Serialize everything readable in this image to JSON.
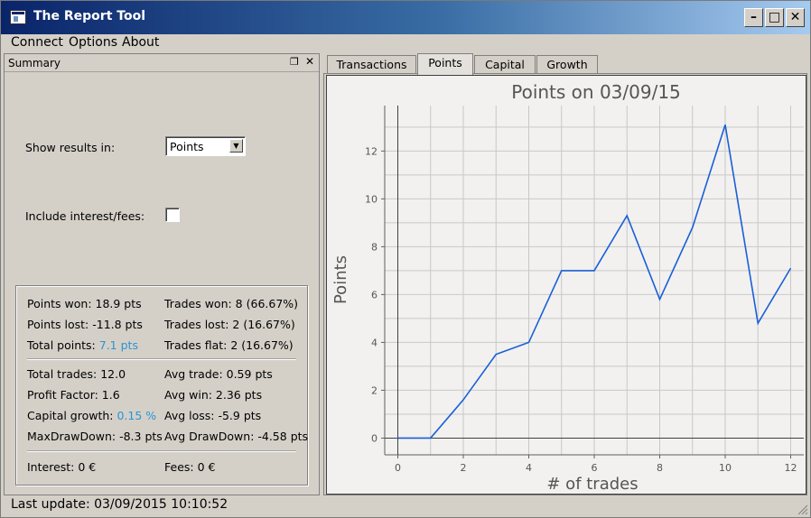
{
  "window": {
    "title": "The Report Tool"
  },
  "menu": {
    "connect": "Connect",
    "options": "Options",
    "about": "About"
  },
  "summary": {
    "title": "Summary",
    "show_results_label": "Show results in:",
    "show_results_value": "Points",
    "include_interest_label": "Include interest/fees:",
    "include_interest_checked": false,
    "stats": {
      "points_won": "Points won: 18.9 pts",
      "trades_won": "Trades won: 8 (66.67%)",
      "points_lost": "Points lost: -11.8 pts",
      "trades_lost": "Trades lost: 2 (16.67%)",
      "total_points_label": "Total points: ",
      "total_points_value": "7.1 pts",
      "trades_flat": "Trades flat: 2 (16.67%)",
      "total_trades": "Total trades: 12.0",
      "avg_trade": "Avg trade: 0.59 pts",
      "profit_factor": "Profit Factor: 1.6",
      "avg_win": "Avg win: 2.36 pts",
      "capital_growth_label": "Capital growth: ",
      "capital_growth_value": "0.15 %",
      "avg_loss": "Avg loss: -5.9 pts",
      "max_drawdown": "MaxDrawDown: -8.3 pts",
      "avg_drawdown": "Avg DrawDown: -4.58 pts",
      "interest": "Interest: 0 €",
      "fees": "Fees: 0 €"
    }
  },
  "status": {
    "last_update": "Last update: 03/09/2015 10:10:52"
  },
  "tabs": [
    {
      "label": "Transactions",
      "active": false
    },
    {
      "label": "Points",
      "active": true
    },
    {
      "label": "Capital",
      "active": false
    },
    {
      "label": "Growth",
      "active": false
    }
  ],
  "colors": {
    "accent_blue": "#2a94d6",
    "line": "#1a5fd6"
  },
  "chart_data": {
    "type": "line",
    "title": "Points on 03/09/15",
    "xlabel": "# of trades",
    "ylabel": "Points",
    "xlim": [
      -0.4,
      12.4
    ],
    "ylim": [
      -0.7,
      13.9
    ],
    "xticks": [
      0,
      2,
      4,
      6,
      8,
      10,
      12
    ],
    "yticks": [
      0,
      2,
      4,
      6,
      8,
      10,
      12
    ],
    "grid": true,
    "series": [
      {
        "x": [
          0,
          1,
          2,
          3,
          4,
          5,
          6,
          7,
          8,
          9,
          10,
          11,
          12
        ],
        "values": [
          0,
          0,
          1.6,
          3.5,
          4.0,
          7.0,
          7.0,
          9.3,
          5.8,
          8.8,
          13.1,
          4.8,
          7.1
        ]
      }
    ]
  }
}
